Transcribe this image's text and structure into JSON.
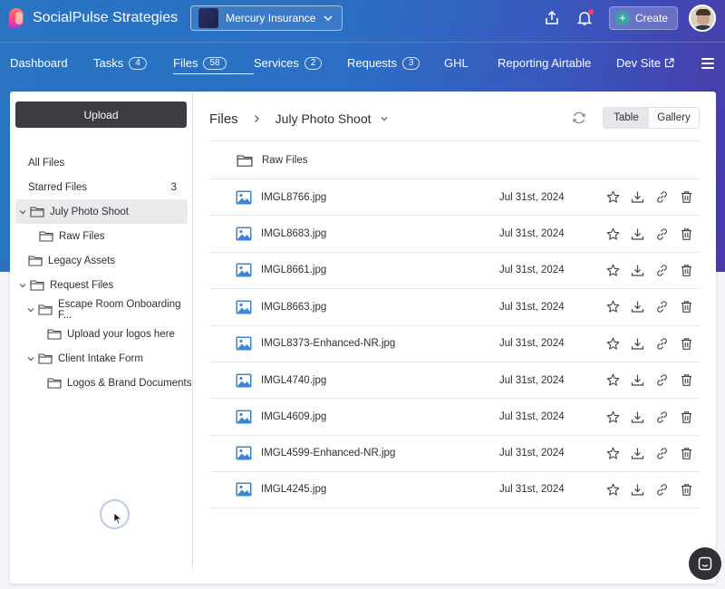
{
  "header": {
    "brand": "SocialPulse Strategies",
    "workspace": "Mercury Insurance",
    "create_label": "Create",
    "create_plus": "+"
  },
  "nav": {
    "items": [
      {
        "label": "Dashboard"
      },
      {
        "label": "Tasks",
        "badge": "4"
      },
      {
        "label": "Files",
        "badge": "58"
      },
      {
        "label": "Services",
        "badge": "2"
      },
      {
        "label": "Requests",
        "badge": "3"
      },
      {
        "label": "GHL"
      },
      {
        "label": "Reporting Airtable"
      },
      {
        "label": "Dev Site"
      }
    ]
  },
  "sidebar": {
    "upload_label": "Upload",
    "tree": [
      {
        "label": "All Files"
      },
      {
        "label": "Starred Files",
        "count": "3"
      },
      {
        "label": "July Photo Shoot"
      },
      {
        "label": "Raw Files"
      },
      {
        "label": "Legacy Assets"
      },
      {
        "label": "Request Files"
      },
      {
        "label": "Escape Room Onboarding F..."
      },
      {
        "label": "Upload your logos here"
      },
      {
        "label": "Client Intake Form"
      },
      {
        "label": "Logos & Brand Documents"
      }
    ]
  },
  "content": {
    "breadcrumb_root": "Files",
    "breadcrumb_current": "July Photo Shoot",
    "view_table": "Table",
    "view_gallery": "Gallery",
    "folder_row": "Raw Files",
    "files": [
      {
        "name": "IMGL8766.jpg",
        "date": "Jul 31st, 2024"
      },
      {
        "name": "IMGL8683.jpg",
        "date": "Jul 31st, 2024"
      },
      {
        "name": "IMGL8661.jpg",
        "date": "Jul 31st, 2024"
      },
      {
        "name": "IMGL8663.jpg",
        "date": "Jul 31st, 2024"
      },
      {
        "name": "IMGL8373-Enhanced-NR.jpg",
        "date": "Jul 31st, 2024"
      },
      {
        "name": "IMGL4740.jpg",
        "date": "Jul 31st, 2024"
      },
      {
        "name": "IMGL4609.jpg",
        "date": "Jul 31st, 2024"
      },
      {
        "name": "IMGL4599-Enhanced-NR.jpg",
        "date": "Jul 31st, 2024"
      },
      {
        "name": "IMGL4245.jpg",
        "date": "Jul 31st, 2024"
      }
    ]
  },
  "colors": {
    "header_gradient_start": "#2a74c2",
    "header_gradient_end": "#4a3aa8",
    "upload_button": "#3b3d42",
    "image_icon": "#3a86d6",
    "notification_dot": "#ff3b6b"
  }
}
